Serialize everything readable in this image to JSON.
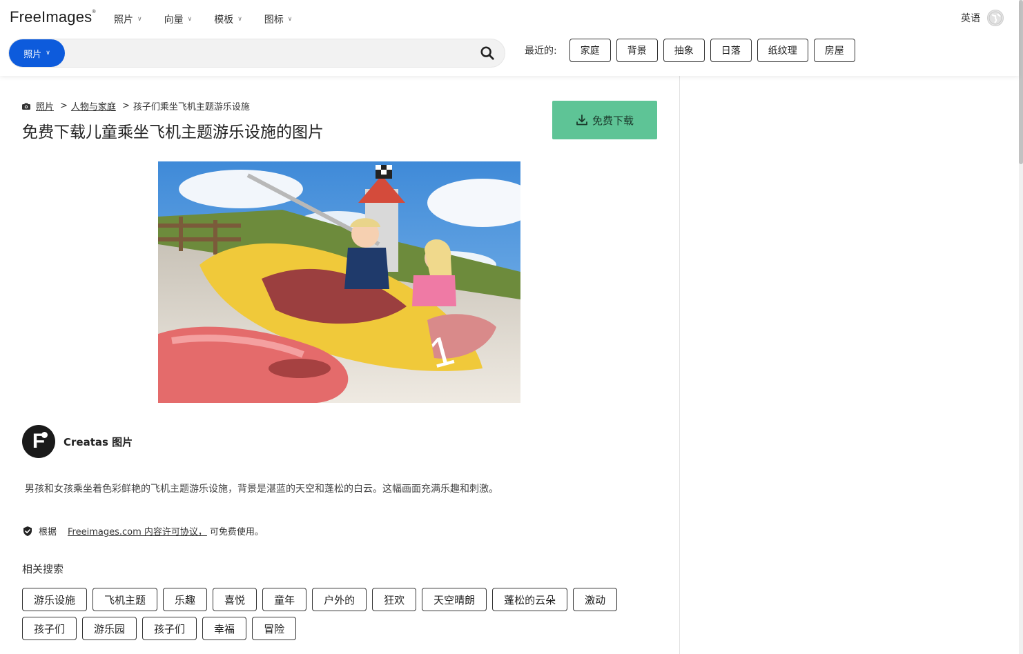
{
  "header": {
    "logo_main": "FreeImages",
    "logo_mark": "®",
    "nav": [
      {
        "label": "照片"
      },
      {
        "label": "向量"
      },
      {
        "label": "模板"
      },
      {
        "label": "图标"
      }
    ],
    "language": "英语"
  },
  "search": {
    "type_label": "照片",
    "value": "",
    "placeholder": ""
  },
  "recent": {
    "label": "最近的:",
    "items": [
      "家庭",
      "背景",
      "抽象",
      "日落",
      "纸纹理",
      "房屋"
    ]
  },
  "breadcrumb": {
    "items": [
      "照片",
      "人物与家庭",
      "孩子们乘坐飞机主题游乐设施"
    ],
    "separator": ">"
  },
  "page": {
    "title": "免费下载儿童乘坐飞机主题游乐设施的图片",
    "download_label": "免费下载"
  },
  "author": {
    "initial": "F",
    "name": "Creatas 图片"
  },
  "description": "男孩和女孩乘坐着色彩鲜艳的飞机主题游乐设施，背景是湛蓝的天空和蓬松的白云。这幅画面充满乐趣和刺激。",
  "license": {
    "prefix": "根据",
    "link": "Freeimages.com 内容许可协议，",
    "suffix": "可免费使用。"
  },
  "related": {
    "label": "相关搜索",
    "tags": [
      "游乐设施",
      "飞机主题",
      "乐趣",
      "喜悦",
      "童年",
      "户外的",
      "狂欢",
      "天空晴朗",
      "蓬松的云朵",
      "激动",
      "孩子们",
      "游乐园",
      "孩子们",
      "幸福",
      "冒险"
    ]
  },
  "colors": {
    "brand_blue": "#0d5bdc",
    "download_green": "#5ec496"
  }
}
